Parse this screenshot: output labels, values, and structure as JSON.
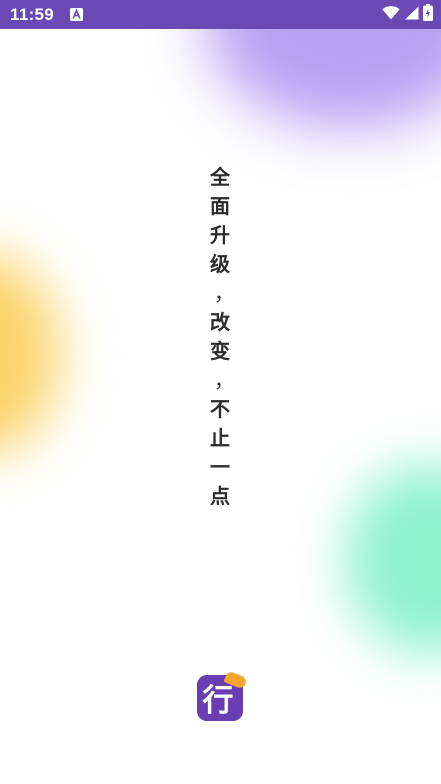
{
  "status_bar": {
    "time": "11:59",
    "notification_icon": "a-letter-icon",
    "wifi_icon": "wifi-icon",
    "signal_icon": "signal-icon",
    "battery_icon": "battery-charging-icon"
  },
  "splash": {
    "slogan": [
      "全",
      "面",
      "升",
      "级",
      "，",
      "改",
      "变",
      "，",
      "不",
      "止",
      "一",
      "点"
    ],
    "logo_text": "行",
    "logo_icon": "app-logo-icon"
  },
  "colors": {
    "status_bar": "#6a49b5",
    "logo_background": "#6a3eb3",
    "logo_badge": "#f3a62a",
    "blob_purple": "#b39cf3",
    "blob_yellow": "#fbd36a",
    "blob_green": "#8ef2cf"
  }
}
